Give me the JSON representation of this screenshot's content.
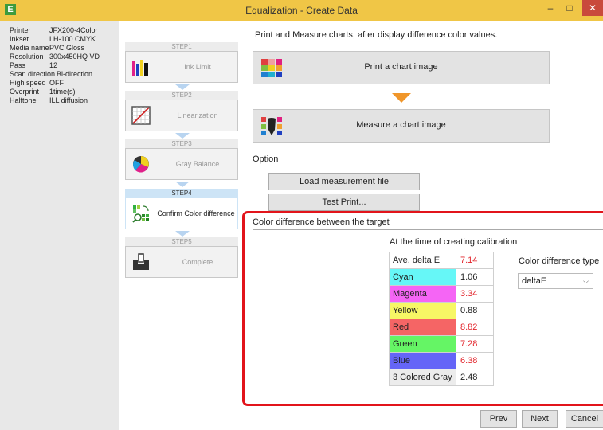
{
  "window": {
    "title": "Equalization - Create Data",
    "app_icon": "E",
    "minimize": "–",
    "maximize": "□",
    "close": "✕"
  },
  "printer_info": [
    {
      "key": "Printer",
      "value": "JFX200-4Color"
    },
    {
      "key": "Inkset",
      "value": "LH-100 CMYK"
    },
    {
      "key": "Media name",
      "value": "PVC Gloss"
    },
    {
      "key": "Resolution",
      "value": "300x450HQ VD"
    },
    {
      "key": "Pass",
      "value": "12"
    },
    {
      "key": "Scan direction",
      "value": "Bi-direction"
    },
    {
      "key": "High speed",
      "value": "OFF"
    },
    {
      "key": "Overprint",
      "value": "1time(s)"
    },
    {
      "key": "Halftone",
      "value": "ILL diffusion"
    }
  ],
  "steps": [
    {
      "head": "STEP1",
      "label": "Ink Limit"
    },
    {
      "head": "STEP2",
      "label": "Linearization"
    },
    {
      "head": "STEP3",
      "label": "Gray Balance"
    },
    {
      "head": "STEP4",
      "label": "Confirm Color difference"
    },
    {
      "head": "STEP5",
      "label": "Complete"
    }
  ],
  "main": {
    "instruction": "Print and Measure charts, after display difference color values.",
    "print_button": "Print a chart image",
    "measure_button": "Measure a chart image",
    "option_label": "Option",
    "load_button": "Load measurement file",
    "test_print_button": "Test Print..."
  },
  "color_difference": {
    "title": "Color difference between the target",
    "subtitle": "At the time of creating calibration",
    "type_label": "Color difference type",
    "type_value": "deltaE",
    "rows": [
      {
        "name": "Ave. delta E",
        "value": "7.14",
        "bg": "#ffffff",
        "red": true
      },
      {
        "name": "Cyan",
        "value": "1.06",
        "bg": "#66f7f7",
        "red": false
      },
      {
        "name": "Magenta",
        "value": "3.34",
        "bg": "#f565f5",
        "red": true
      },
      {
        "name": "Yellow",
        "value": "0.88",
        "bg": "#f7f765",
        "red": false
      },
      {
        "name": "Red",
        "value": "8.82",
        "bg": "#f56565",
        "red": true
      },
      {
        "name": "Green",
        "value": "7.28",
        "bg": "#65f565",
        "red": true
      },
      {
        "name": "Blue",
        "value": "6.38",
        "bg": "#6565f7",
        "red": true
      },
      {
        "name": "3 Colored Gray",
        "value": "2.48",
        "bg": "#ececec",
        "red": false
      }
    ]
  },
  "footer": {
    "prev": "Prev",
    "next": "Next",
    "cancel": "Cancel"
  }
}
